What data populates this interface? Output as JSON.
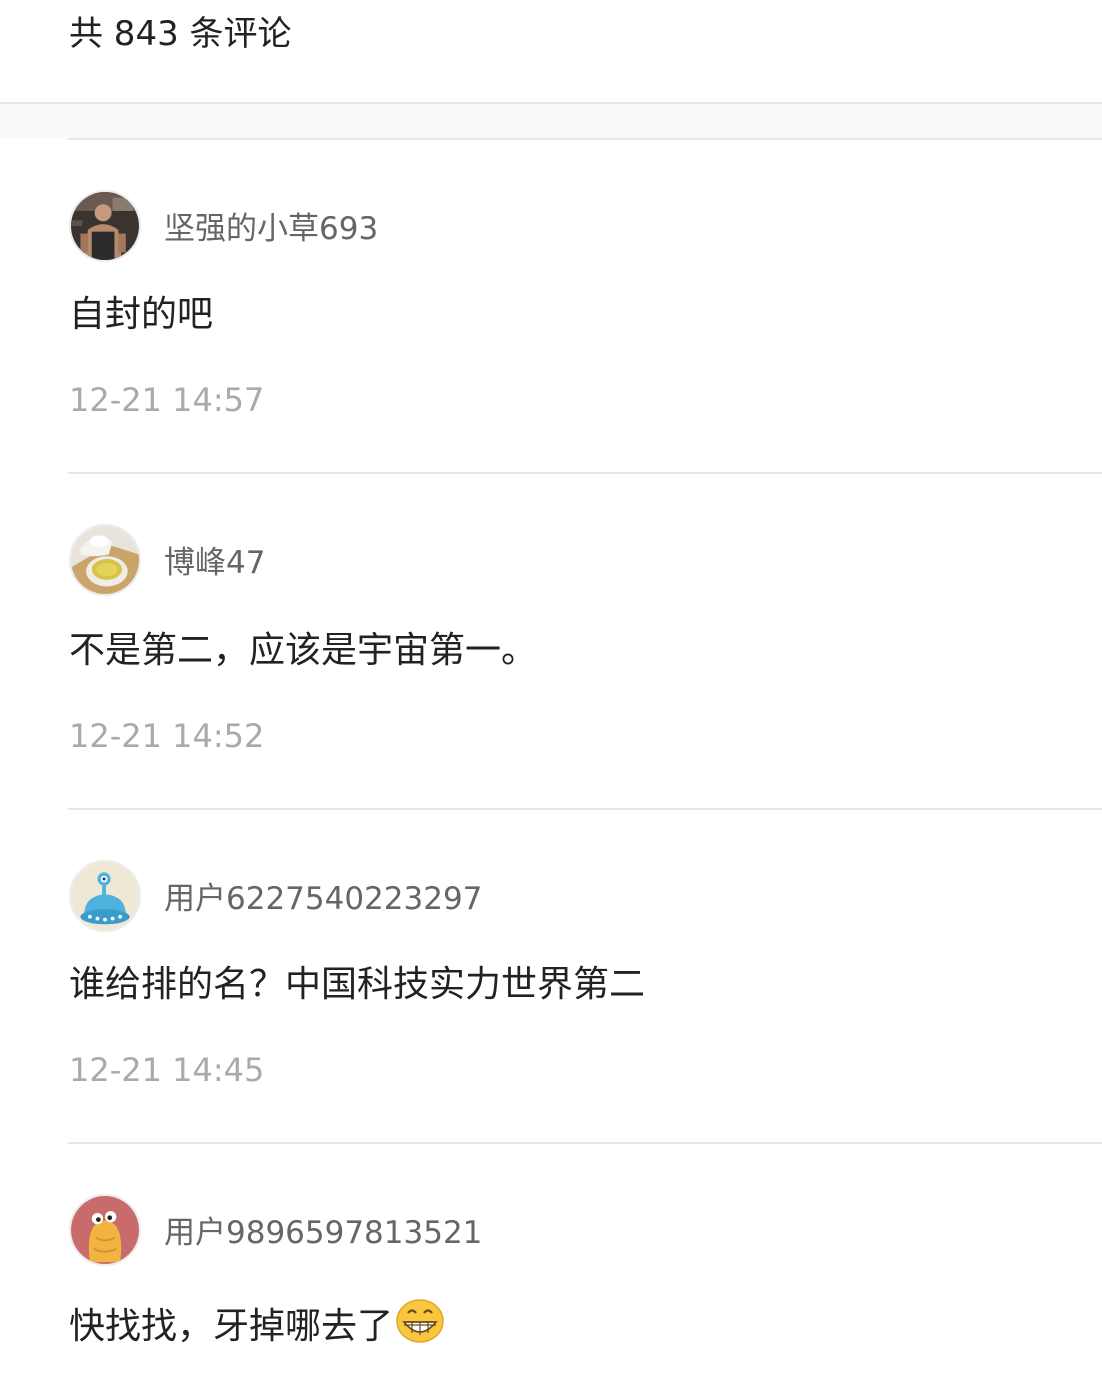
{
  "header": {
    "title": "共 843 条评论"
  },
  "comments": [
    {
      "username": "坚强的小草693",
      "avatar_icon": "gym-photo-avatar-icon",
      "text": "自封的吧",
      "time": "12-21 14:57"
    },
    {
      "username": "博峰47",
      "avatar_icon": "tea-cup-avatar-icon",
      "text": "不是第二，应该是宇宙第一。",
      "time": "12-21 14:52"
    },
    {
      "username": "用户6227540223297",
      "avatar_icon": "blue-alien-avatar-icon",
      "text": "谁给排的名？中国科技实力世界第二",
      "time": "12-21 14:45"
    },
    {
      "username": "用户9896597813521",
      "avatar_icon": "yellow-monster-avatar-icon",
      "text": "快找找，牙掉哪去了",
      "emoji": "grinning-face-emoji-icon"
    }
  ],
  "colors": {
    "text_primary": "#222222",
    "text_username": "#666666",
    "text_time": "#aaaaaa",
    "divider": "#e6e6e6"
  }
}
